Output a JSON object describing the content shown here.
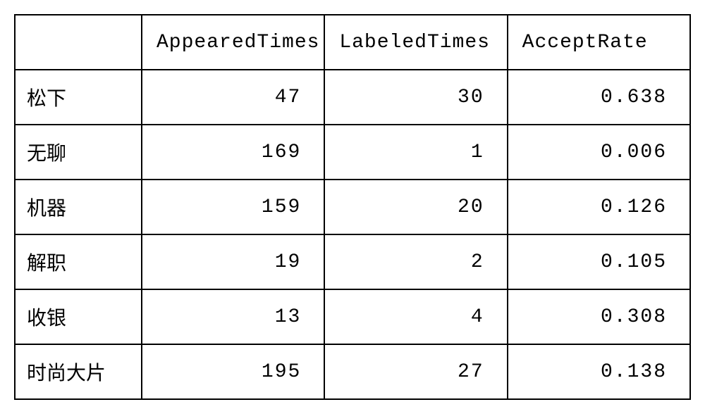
{
  "chart_data": {
    "type": "table",
    "headers": [
      "",
      "AppearedTimes",
      "LabeledTimes",
      "AcceptRate"
    ],
    "rows": [
      {
        "name": "松下",
        "appeared": "47",
        "labeled": "30",
        "rate": "0.638"
      },
      {
        "name": "无聊",
        "appeared": "169",
        "labeled": "1",
        "rate": "0.006"
      },
      {
        "name": "机器",
        "appeared": "159",
        "labeled": "20",
        "rate": "0.126"
      },
      {
        "name": "解职",
        "appeared": "19",
        "labeled": "2",
        "rate": "0.105"
      },
      {
        "name": "收银",
        "appeared": "13",
        "labeled": "4",
        "rate": "0.308"
      },
      {
        "name": "时尚大片",
        "appeared": "195",
        "labeled": "27",
        "rate": "0.138"
      }
    ]
  }
}
